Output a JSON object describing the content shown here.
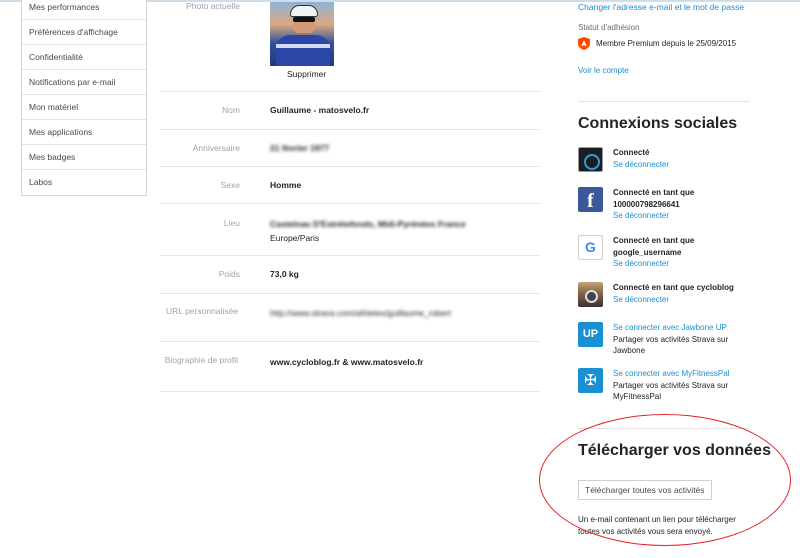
{
  "sidebar": {
    "items": [
      {
        "label": "Mes performances"
      },
      {
        "label": "Préférences d'affichage"
      },
      {
        "label": "Confidentialité"
      },
      {
        "label": "Notifications par e-mail"
      },
      {
        "label": "Mon matériel"
      },
      {
        "label": "Mes applications"
      },
      {
        "label": "Mes badges"
      },
      {
        "label": "Labos"
      }
    ]
  },
  "profile": {
    "photo_label": "Photo actuelle",
    "delete_link": "Supprimer",
    "name_label": "Nom",
    "name_value": "Guillaume - matosvelo.fr",
    "birthday_label": "Anniversaire",
    "birthday_value": "21 février 1977",
    "sex_label": "Sexe",
    "sex_value": "Homme",
    "location_label": "Lieu",
    "location_value": "Castelnau D'Estrétefonds, Midi-Pyrénées France",
    "timezone_value": "Europe/Paris",
    "weight_label": "Poids",
    "weight_value": "73,0 kg",
    "url_label": "URL personnalisée",
    "url_value": "http://www.strava.com/athletes/guillaume_robert",
    "bio_label": "Biographie de profil",
    "bio_value": "www.cycloblog.fr & www.matosvelo.fr"
  },
  "account": {
    "change_link": "Changer l'adresse e-mail et le mot de passe",
    "membership_label": "Statut d'adhésion",
    "membership_text": "Membre Premium depuis le 25/09/2015",
    "view_account": "Voir le compte"
  },
  "social": {
    "title": "Connexions sociales",
    "items": [
      {
        "icon": "garmin-icon",
        "status": "Connecté",
        "action": "Se déconnecter"
      },
      {
        "icon": "facebook-icon",
        "status": "Connecté en tant que 100000798296641",
        "action": "Se déconnecter"
      },
      {
        "icon": "google-icon",
        "status": "Connecté en tant que google_username",
        "action": "Se déconnecter"
      },
      {
        "icon": "instagram-icon",
        "status": "Connecté en tant que cycloblog",
        "action": "Se déconnecter"
      },
      {
        "icon": "jawbone-up-icon",
        "action": "Se connecter avec Jawbone UP",
        "desc": "Partager vos activités Strava sur Jawbone"
      },
      {
        "icon": "myfitnesspal-icon",
        "action": "Se connecter avec MyFitnessPal",
        "desc": "Partager vos activités Strava sur MyFitnessPal"
      }
    ]
  },
  "download": {
    "title": "Télécharger vos données",
    "button": "Télécharger toutes vos activités",
    "note": "Un e-mail contenant un lien pour télécharger toutes vos activités vous sera envoyé."
  },
  "colors": {
    "link": "#1a8fd1",
    "premium": "#fc4c02",
    "highlight": "#e32228"
  }
}
